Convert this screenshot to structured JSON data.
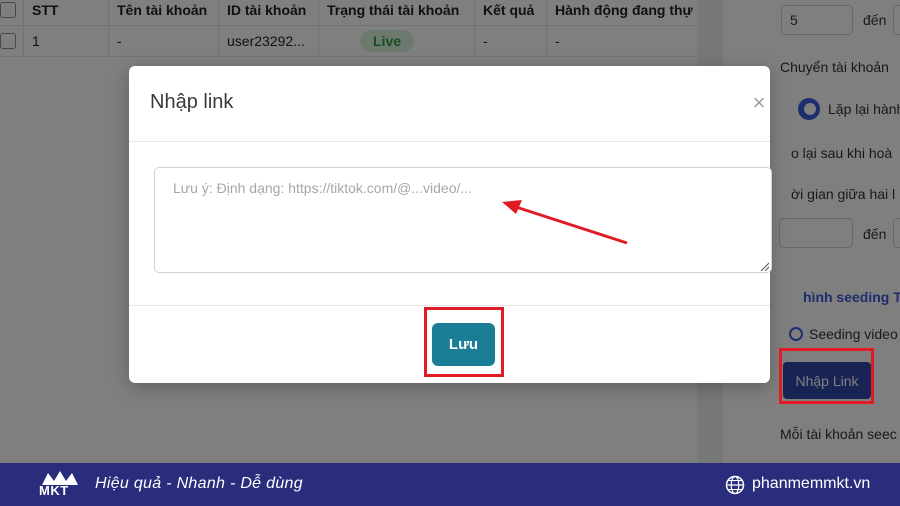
{
  "table": {
    "headers": [
      "STT",
      "Tên tài khoản",
      "ID tài khoản",
      "Trạng thái tài khoản",
      "Kết quả",
      "Hành động đang thự"
    ],
    "rows": [
      {
        "stt": "1",
        "name": "-",
        "id": "user23292...",
        "status": "Live",
        "result": "-",
        "action": "-"
      }
    ]
  },
  "panel": {
    "range_from": "5",
    "range_to_label": "đến",
    "switch_account_label": "Chuyển tài khoản",
    "repeat_label": "Lặp lại hành",
    "repeat_after_label": "o lại sau khi hoà",
    "interval_label": "ời gian giữa hai l",
    "interval_to_label": "đến",
    "seeding_config_label": "hình seeding T",
    "seeding_video_label": "Seeding video",
    "import_link_button": "Nhập Link",
    "per_account_label": "Mỗi tài khoản seec"
  },
  "modal": {
    "title": "Nhập link",
    "close_symbol": "×",
    "textarea_placeholder": "Lưu ý: Định dạng: https://tiktok.com/@...video/...",
    "textarea_value": "",
    "save_button": "Lưu"
  },
  "banner": {
    "logo_text": "MKT",
    "slogan": "Hiệu quả - Nhanh - Dễ dùng",
    "website": "phanmemmkt.vn"
  },
  "colors": {
    "overlay": "rgba(0,0,0,0.5)",
    "save_button": "#1a7d95",
    "highlight": "#e01b24",
    "banner": "#2a2d7c",
    "live_badge_bg": "#d7f3dc",
    "live_badge_text": "#2e9d4a"
  }
}
